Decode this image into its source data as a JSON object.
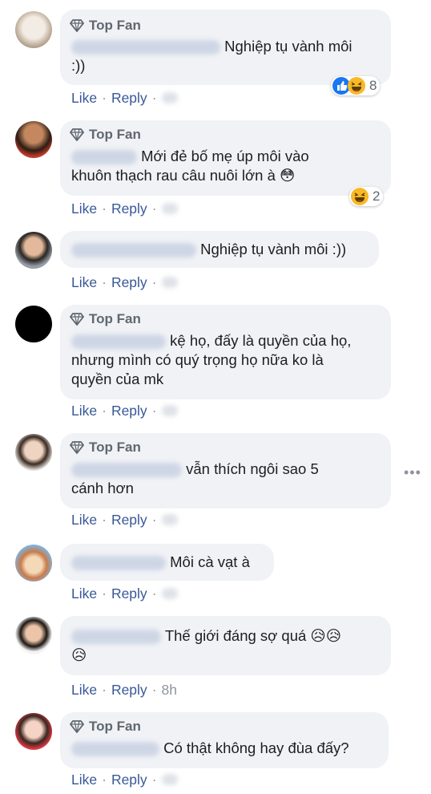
{
  "badge_label": "Top Fan",
  "actions": {
    "like": "Like",
    "reply": "Reply",
    "separator": "·"
  },
  "comments": [
    {
      "text_lines": [
        "Nghiệp tụ vành môi",
        ":))"
      ],
      "reactions": {
        "count": "8",
        "types": [
          "like-icon",
          "haha-icon"
        ]
      }
    },
    {
      "text_lines": [
        "Mới đẻ bố mẹ úp môi vào",
        "khuôn thạch rau câu nuôi lớn à 😳"
      ],
      "reactions": {
        "count": "2",
        "types": [
          "haha-icon"
        ]
      }
    },
    {
      "text_lines": [
        "Nghiệp tụ vành môi :))"
      ]
    },
    {
      "text_lines": [
        "kệ họ, đấy là quyền của họ,",
        "nhưng mình có quý trọng họ nữa ko là",
        "quyền của mk"
      ]
    },
    {
      "text_lines": [
        "vẫn thích ngôi sao 5",
        "cánh hơn"
      ]
    },
    {
      "text_lines": [
        "Môi cà vạt à"
      ]
    },
    {
      "text_lines": [
        "Thế giới đáng sợ quá 😥😥",
        "😥"
      ],
      "time": "8h"
    },
    {
      "text_lines": [
        "Có thật không hay đùa đấy?"
      ]
    }
  ]
}
